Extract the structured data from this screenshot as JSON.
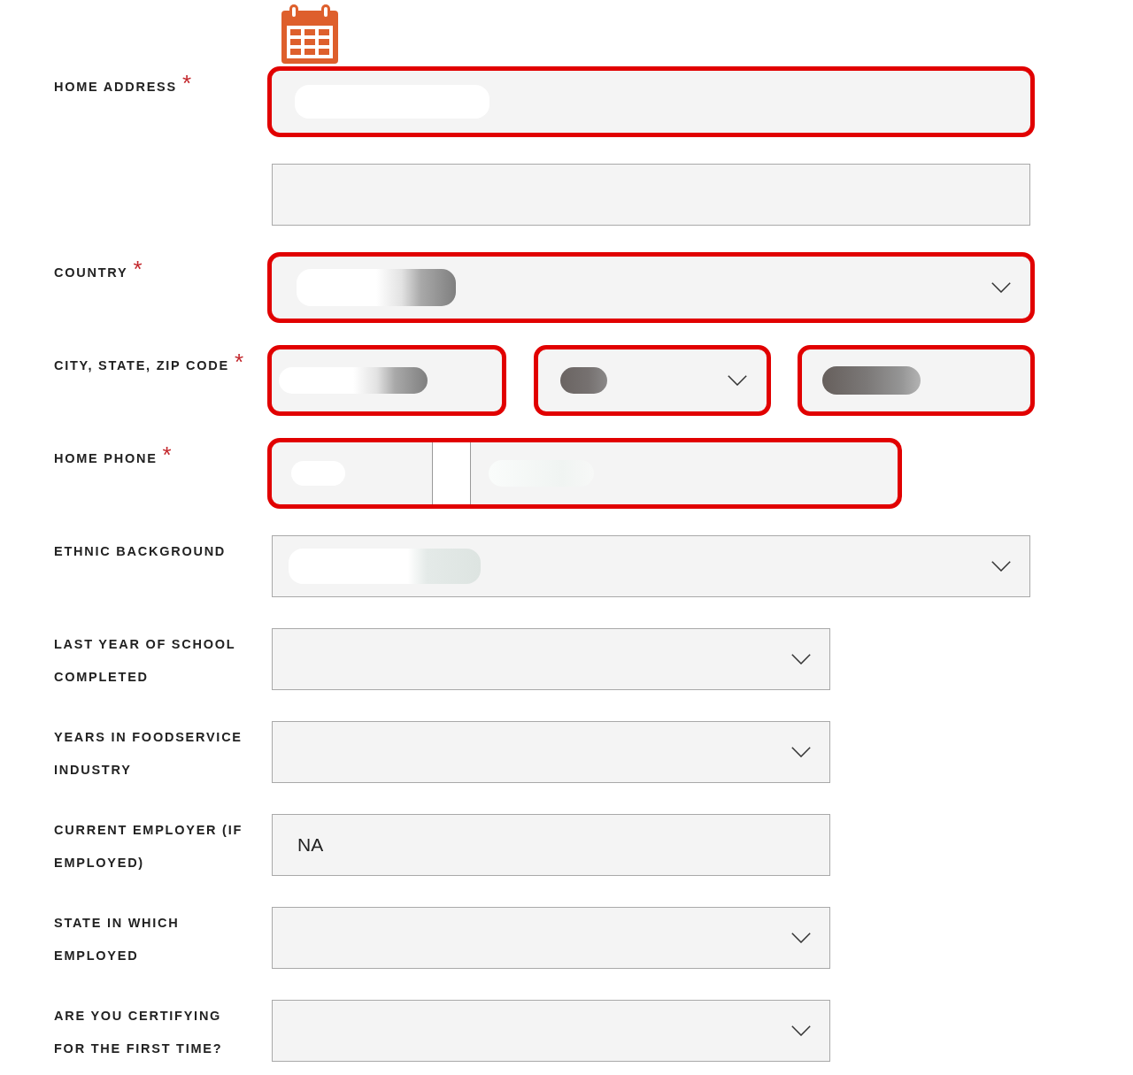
{
  "rows": [
    {
      "label": "HOME ADDRESS",
      "required_mark": "*",
      "fields": [
        {
          "kind": "text",
          "highlighted": true,
          "redacted": true
        }
      ]
    },
    {
      "fields": [
        {
          "kind": "text",
          "highlighted": false,
          "redacted": false
        }
      ]
    },
    {
      "label": "COUNTRY",
      "required_mark": "*",
      "fields": [
        {
          "kind": "select",
          "highlighted": true,
          "redacted": true
        }
      ]
    },
    {
      "label": "CITY, STATE, ZIP CODE",
      "required_mark": "*",
      "fields": [
        {
          "kind": "text",
          "highlighted": true,
          "redacted": true
        },
        {
          "kind": "select",
          "highlighted": true,
          "redacted": true
        },
        {
          "kind": "text",
          "highlighted": true,
          "redacted": true
        }
      ]
    },
    {
      "label": "HOME PHONE",
      "required_mark": "*",
      "fields": [
        {
          "kind": "phone",
          "highlighted": true,
          "parts": [
            {
              "kind": "input",
              "redacted": true
            },
            {
              "kind": "separator"
            },
            {
              "kind": "input",
              "redacted": true
            }
          ]
        }
      ]
    },
    {
      "label": "ETHNIC BACKGROUND",
      "fields": [
        {
          "kind": "select",
          "highlighted": false,
          "redacted": true
        }
      ]
    },
    {
      "label": "LAST YEAR OF SCHOOL COMPLETED",
      "fields": [
        {
          "kind": "select",
          "highlighted": false,
          "redacted": false
        }
      ]
    },
    {
      "label": "YEARS IN FOODSERVICE INDUSTRY",
      "fields": [
        {
          "kind": "select",
          "highlighted": false,
          "redacted": false
        }
      ]
    },
    {
      "label": "CURRENT EMPLOYER (IF EMPLOYED)",
      "fields": [
        {
          "kind": "text",
          "highlighted": false,
          "value": "NA"
        }
      ]
    },
    {
      "label": "STATE IN WHICH EMPLOYED",
      "fields": [
        {
          "kind": "select",
          "highlighted": false,
          "redacted": false
        }
      ]
    },
    {
      "label": "ARE YOU CERTIFYING FOR THE FIRST TIME?",
      "fields": [
        {
          "kind": "select",
          "highlighted": false,
          "redacted": false
        }
      ]
    }
  ]
}
